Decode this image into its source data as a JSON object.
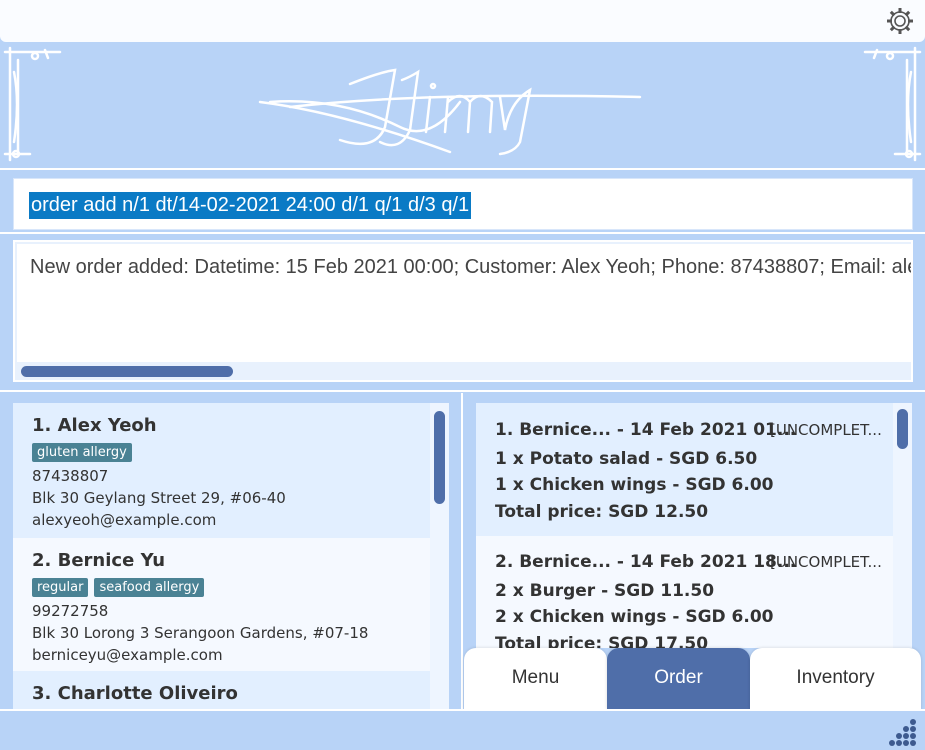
{
  "app": {
    "logo_text": "Jimy",
    "settings_icon": "gear-icon",
    "resize_icon": "resize-grip-icon"
  },
  "command": {
    "value": "order add n/1 dt/14-02-2021 24:00 d/1 q/1 d/3 q/1"
  },
  "result": {
    "message": "New order added: Datetime: 15 Feb 2021 00:00; Customer: Alex Yeoh; Phone: 87438807; Email: alexyeoh@example.com"
  },
  "persons": [
    {
      "title": "1.  Alex Yeoh",
      "tags": [
        "gluten allergy"
      ],
      "phone": "87438807",
      "address": "Blk 30 Geylang Street 29, #06-40",
      "email": "alexyeoh@example.com"
    },
    {
      "title": "2.  Bernice Yu",
      "tags": [
        "regular",
        "seafood allergy"
      ],
      "phone": "99272758",
      "address": "Blk 30 Lorong 3 Serangoon Gardens, #07-18",
      "email": "berniceyu@example.com"
    },
    {
      "title": "3.  Charlotte Oliveiro",
      "tags": [],
      "phone": "",
      "address": "",
      "email": ""
    }
  ],
  "orders": [
    {
      "title": "1.  Bernice...  - 14 Feb 2021 01...",
      "status": "[UNCOMPLET...",
      "items": [
        "1 x Potato salad - SGD 6.50",
        "1 x Chicken wings - SGD 6.00"
      ],
      "total": "Total price: SGD 12.50"
    },
    {
      "title": "2.  Bernice...  - 14 Feb 2021 18...",
      "status": "[UNCOMPLET...",
      "items": [
        "2 x Burger - SGD 11.50",
        "2 x Chicken wings - SGD 6.00"
      ],
      "total": "Total price: SGD 17.50"
    }
  ],
  "tabs": [
    {
      "label": "Menu",
      "active": false
    },
    {
      "label": "Order",
      "active": true
    },
    {
      "label": "Inventory",
      "active": false
    }
  ]
}
